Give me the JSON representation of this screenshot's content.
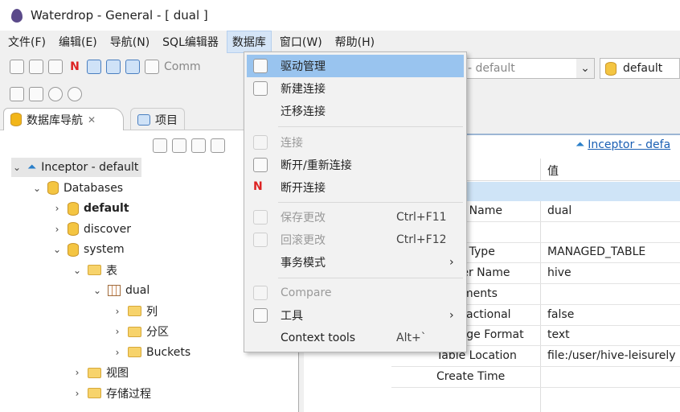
{
  "window": {
    "title": "Waterdrop - General - [ dual ]"
  },
  "menubar": [
    "文件(F)",
    "编辑(E)",
    "导航(N)",
    "SQL编辑器",
    "数据库",
    "窗口(W)",
    "帮助(H)"
  ],
  "toolbar": {
    "commit_label": "Comm",
    "connection_combo": "- default",
    "schema_combo": "default"
  },
  "left_panel": {
    "tabs": [
      "数据库导航",
      "项目"
    ],
    "tree": [
      {
        "label": "Inceptor - default",
        "level": 0,
        "expanded": true,
        "icon": "connection-icon"
      },
      {
        "label": "Databases",
        "level": 1,
        "expanded": true,
        "icon": "databases-icon"
      },
      {
        "label": "default",
        "level": 2,
        "expanded": false,
        "icon": "database-icon",
        "bold": true
      },
      {
        "label": "discover",
        "level": 2,
        "expanded": false,
        "icon": "database-icon"
      },
      {
        "label": "system",
        "level": 2,
        "expanded": true,
        "icon": "database-icon"
      },
      {
        "label": "表",
        "level": 3,
        "expanded": true,
        "icon": "folder-icon"
      },
      {
        "label": "dual",
        "level": 4,
        "expanded": true,
        "icon": "table-icon"
      },
      {
        "label": "列",
        "level": 5,
        "expanded": false,
        "icon": "folder-icon"
      },
      {
        "label": "分区",
        "level": 5,
        "expanded": false,
        "icon": "folder-icon"
      },
      {
        "label": "Buckets",
        "level": 5,
        "expanded": false,
        "icon": "folder-icon"
      },
      {
        "label": "视图",
        "level": 3,
        "expanded": false,
        "icon": "folder-icon"
      },
      {
        "label": "存储过程",
        "level": 3,
        "expanded": false,
        "icon": "folder-icon"
      }
    ]
  },
  "editor": {
    "link": "Inceptor - defa",
    "value_header": "值",
    "properties": [
      {
        "key": "Table Name",
        "value": "dual"
      },
      {
        "key": "",
        "value": ""
      },
      {
        "key": "Table Type",
        "value": "MANAGED_TABLE"
      },
      {
        "key": "Owner Name",
        "value": "hive"
      },
      {
        "key": "Comments",
        "value": ""
      },
      {
        "key": "Transactional",
        "value": "false"
      },
      {
        "key": "Storage Format",
        "value": "text"
      },
      {
        "key": "Table Location",
        "value": "file:/user/hive-leisurely"
      },
      {
        "key": "Create Time",
        "value": ""
      }
    ]
  },
  "db_menu": {
    "items": [
      {
        "label": "驱动管理",
        "highlighted": true
      },
      {
        "label": "新建连接"
      },
      {
        "label": "迁移连接"
      },
      {
        "label": "连接",
        "disabled": true
      },
      {
        "label": "断开/重新连接"
      },
      {
        "label": "断开连接"
      },
      {
        "label": "保存更改",
        "shortcut": "Ctrl+F11",
        "disabled": true
      },
      {
        "label": "回滚更改",
        "shortcut": "Ctrl+F12",
        "disabled": true
      },
      {
        "label": "事务模式",
        "submenu": "›"
      },
      {
        "label": "Compare",
        "disabled": true
      },
      {
        "label": "工具",
        "submenu": "›"
      },
      {
        "label": "Context tools",
        "shortcut": "Alt+`"
      }
    ]
  }
}
